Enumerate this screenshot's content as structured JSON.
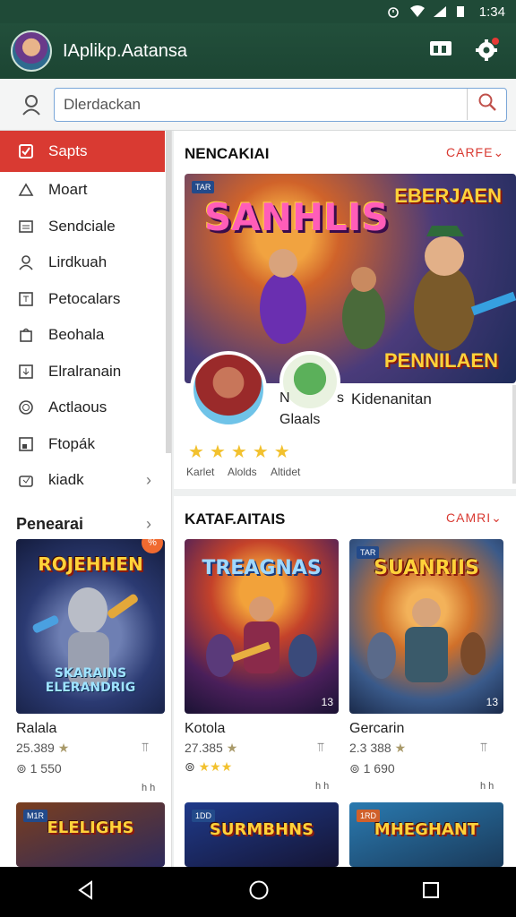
{
  "status": {
    "time": "1:34"
  },
  "header": {
    "title": "IAplikp.Aatansa"
  },
  "search": {
    "placeholder": "Dlerdackan"
  },
  "sidebar": {
    "items": [
      {
        "label": "Sapts",
        "icon": "checkbox-icon"
      },
      {
        "label": "Moart",
        "icon": "triangle-icon"
      },
      {
        "label": "Sendciale",
        "icon": "card-icon"
      },
      {
        "label": "Lirdkuah",
        "icon": "person-icon"
      },
      {
        "label": "Petocalars",
        "icon": "tablet-icon"
      },
      {
        "label": "Beohala",
        "icon": "bag-icon"
      },
      {
        "label": "Elralranain",
        "icon": "download-box-icon"
      },
      {
        "label": "Actlaous",
        "icon": "circle-icon"
      },
      {
        "label": "Ftopák",
        "icon": "window-icon"
      },
      {
        "label": "kiadk",
        "icon": "shopping-bag-icon"
      }
    ],
    "section_title": "Penearai",
    "game": {
      "banner": "ROJEHHEN",
      "banner2": "SKARAINS ELERANDRIG",
      "badge": "%",
      "title": "Ralala",
      "rating": "25.389",
      "installs": "1 550",
      "small": "h h"
    }
  },
  "featured": {
    "section_title": "NENCAKIAI",
    "more": "CARFE",
    "banner_title": "SANHLIS",
    "banner_right": "EBERJAEN",
    "banner_right2": "PENNILAEN",
    "banner_tag": "TAR",
    "overlay_title": "Kidenanitan",
    "overlay_n": "N",
    "overlay_s": "s",
    "overlay_sub": "Glaals",
    "rating_labels": [
      "Karlet",
      "Alolds",
      "Altidet"
    ]
  },
  "catalog": {
    "section_title": "KATAF.AITAIS",
    "more": "CAMRI",
    "games": [
      {
        "banner": "TREAGNAS",
        "tag": "",
        "corner": "13",
        "title": "Kotola",
        "rating": "27.385",
        "small": "h h"
      },
      {
        "banner": "SUANRIIS",
        "tag": "TAR",
        "corner": "13",
        "title": "Gercarin",
        "rating": "2.3 388",
        "installs": "1 690",
        "small": "h h"
      }
    ],
    "bottom": [
      {
        "banner": "ELELIGHS",
        "tag": "M1R"
      },
      {
        "banner": "SURMBHNS",
        "tag": "1DD"
      },
      {
        "banner": "MHEGHANT",
        "tag": "1RD"
      }
    ]
  }
}
